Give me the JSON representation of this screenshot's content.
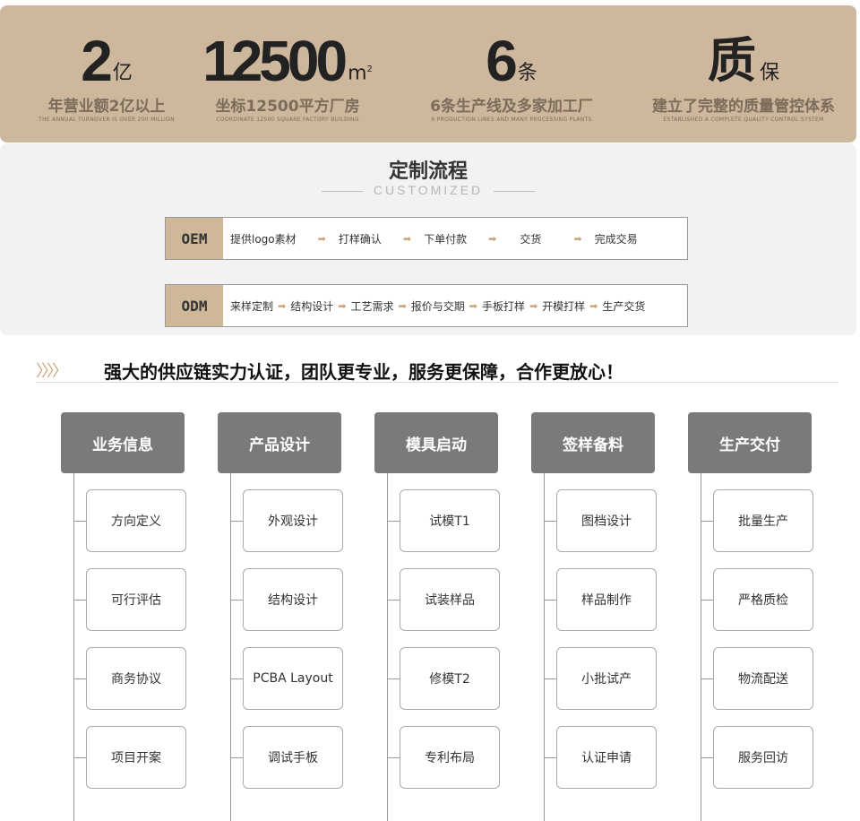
{
  "stats": [
    {
      "num": "2",
      "unit": "亿",
      "sup": "",
      "cn": "年营业额2亿以上",
      "en": "THE ANNUAL TURNOVER IS OVER 200 MILLION"
    },
    {
      "num": "12500",
      "unit": "m",
      "sup": "2",
      "cn": "坐标12500平方厂房",
      "en": "COORDINATE 12500 SQUARE FACTORY BUILDING"
    },
    {
      "num": "6",
      "unit": "条",
      "sup": "",
      "cn": "6条生产线及多家加工厂",
      "en": "6 PRODUCTION LINES AND MANY PROCESSING PLANTS"
    },
    {
      "num": "质",
      "unit": "保",
      "sup": "",
      "cn": "建立了完整的质量管控体系",
      "en": "ESTABLISHED A COMPLETE QUALITY CONTROL SYSTEM"
    }
  ],
  "process": {
    "title": "定制流程",
    "subtitle": "CUSTOMIZED",
    "arrow": "➡",
    "oem": {
      "tag": "OEM",
      "steps": [
        "提供logo素材",
        "打样确认",
        "下单付款",
        "交货",
        "完成交易"
      ]
    },
    "odm": {
      "tag": "ODM",
      "steps": [
        "来样定制",
        "结构设计",
        "工艺需求",
        "报价与交期",
        "手板打样",
        "开模打样",
        "生产交货"
      ]
    }
  },
  "slogan": {
    "chevrons": "〉〉〉〉",
    "text": "强大的供应链实力认证，团队更专业，服务更保障，合作更放心！"
  },
  "columns": [
    {
      "title": "业务信息",
      "items": [
        "方向定义",
        "可行评估",
        "商务协议",
        "项目开案"
      ]
    },
    {
      "title": "产品设计",
      "items": [
        "外观设计",
        "结构设计",
        "PCBA Layout",
        "调试手板"
      ]
    },
    {
      "title": "模具启动",
      "items": [
        "试模T1",
        "试装样品",
        "修模T2",
        "专利布局"
      ]
    },
    {
      "title": "签样备料",
      "items": [
        "图档设计",
        "样品制作",
        "小批试产",
        "认证申请"
      ]
    },
    {
      "title": "生产交付",
      "items": [
        "批量生产",
        "严格质检",
        "物流配送",
        "服务回访"
      ]
    }
  ]
}
